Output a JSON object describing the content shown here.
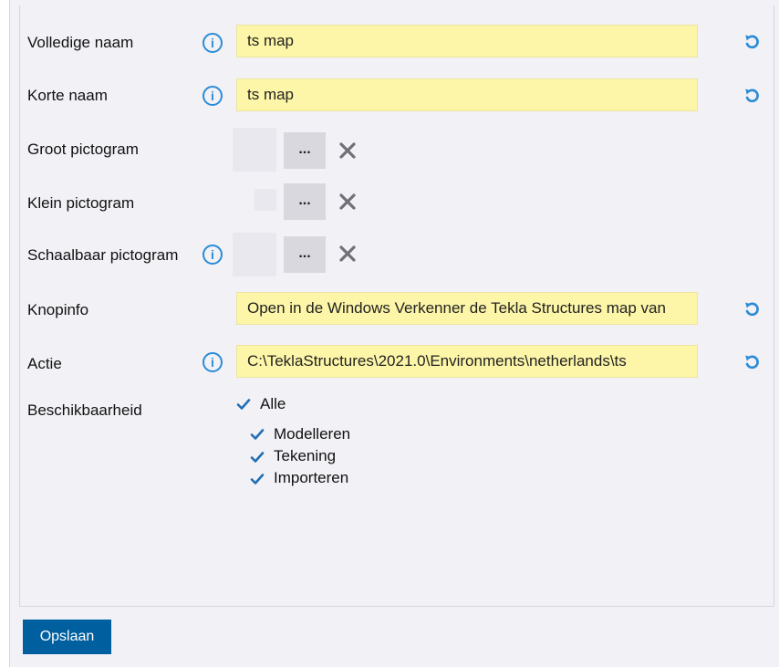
{
  "form": {
    "full_name": {
      "label": "Volledige naam",
      "value": "ts map"
    },
    "short_name": {
      "label": "Korte naam",
      "value": "ts map"
    },
    "large_icon": {
      "label": "Groot pictogram",
      "browse_label": "..."
    },
    "small_icon": {
      "label": "Klein pictogram",
      "browse_label": "..."
    },
    "scalable_icon": {
      "label": "Schaalbaar pictogram",
      "browse_label": "..."
    },
    "tooltip": {
      "label": "Knopinfo",
      "value": "Open in de Windows Verkenner de Tekla Structures map van"
    },
    "action": {
      "label": "Actie",
      "value": "C:\\TeklaStructures\\2021.0\\Environments\\netherlands\\ts"
    },
    "availability": {
      "label": "Beschikbaarheid",
      "all": {
        "label": "Alle",
        "checked": true
      },
      "options": [
        {
          "label": "Modelleren",
          "checked": true
        },
        {
          "label": "Tekening",
          "checked": true
        },
        {
          "label": "Importeren",
          "checked": true
        }
      ]
    }
  },
  "footer": {
    "save_label": "Opslaan"
  },
  "icons": {
    "info": "info-icon",
    "reset": "undo-arrow-icon",
    "clear": "x-icon",
    "check": "checkmark-icon"
  },
  "colors": {
    "accent": "#2b8cd6",
    "field_bg": "#fdf6a8",
    "save_bg": "#005f9f",
    "clear_icon": "#707078"
  }
}
